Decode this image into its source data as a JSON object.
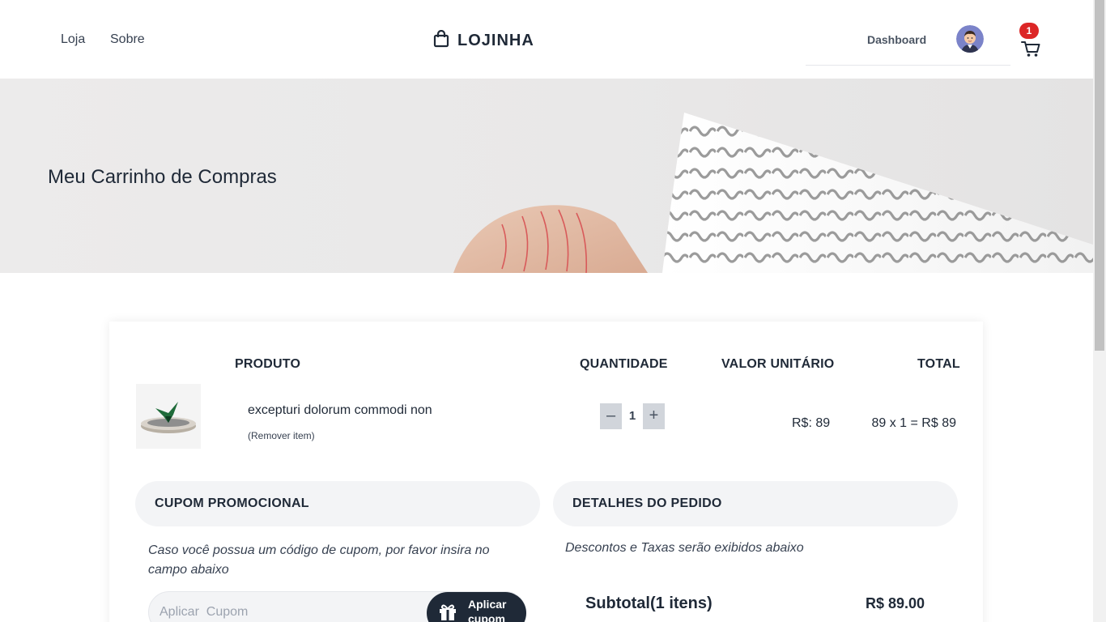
{
  "header": {
    "nav": [
      {
        "label": "Loja"
      },
      {
        "label": "Sobre"
      }
    ],
    "brand": "LOJINHA",
    "dashboard_label": "Dashboard",
    "cart_count": "1"
  },
  "hero": {
    "title": "Meu Carrinho de Compras"
  },
  "cart": {
    "columns": {
      "product": "PRODUTO",
      "quantity": "QUANTIDADE",
      "unit_price": "VALOR UNITÁRIO",
      "total": "TOTAL"
    },
    "items": [
      {
        "name": "excepturi dolorum commodi non",
        "remove_label": "(Remover item)",
        "decrement_label": "–",
        "quantity": "1",
        "increment_label": "+",
        "unit_price": "R$: 89",
        "total": "89 x 1 = R$ 89"
      }
    ]
  },
  "coupon": {
    "heading": "CUPOM PROMOCIONAL",
    "instructions": "Caso você possua um código de cupom, por favor insira no campo abaixo",
    "placeholder": "Aplicar  Cupom",
    "button_label": "Aplicar cupom"
  },
  "order": {
    "heading": "DETALHES DO PEDIDO",
    "note": "Descontos e Taxas serão exibidos abaixo",
    "subtotal_label": "Subtotal(1 itens)",
    "subtotal_value": "R$ 89.00"
  },
  "colors": {
    "badge": "#dc2626",
    "primary_button": "#1f2937",
    "panel_bg": "#f3f4f6"
  }
}
